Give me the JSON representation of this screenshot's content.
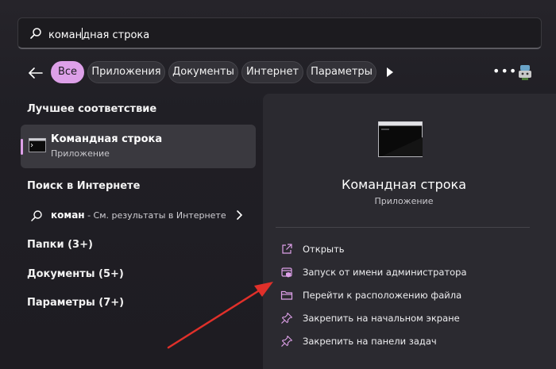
{
  "search": {
    "typed": "коман",
    "rest": "дная строка"
  },
  "filters": {
    "chips": [
      "Все",
      "Приложения",
      "Документы",
      "Интернет",
      "Параметры"
    ],
    "active_index": 0
  },
  "colors": {
    "accent": "#dda0e8",
    "pane": "#2b2a30",
    "annotation_arrow": "#e0302a"
  },
  "best_match": {
    "heading": "Лучшее соответствие",
    "name": "Командная строка",
    "type": "Приложение"
  },
  "web": {
    "heading": "Поиск в Интернете",
    "term": "коман",
    "hint": " - См. результаты в Интернете"
  },
  "sections": {
    "folders": "Папки (3+)",
    "documents": "Документы (5+)",
    "settings": "Параметры (7+)"
  },
  "detail": {
    "title": "Командная строка",
    "subtitle": "Приложение",
    "actions": [
      {
        "icon": "open-external-icon",
        "label": "Открыть"
      },
      {
        "icon": "admin-shield-icon",
        "label": "Запуск от имени администратора"
      },
      {
        "icon": "folder-icon",
        "label": "Перейти к расположению файла"
      },
      {
        "icon": "pin-icon",
        "label": "Закрепить на начальном экране"
      },
      {
        "icon": "pin-icon",
        "label": "Закрепить на панели задач"
      }
    ]
  }
}
